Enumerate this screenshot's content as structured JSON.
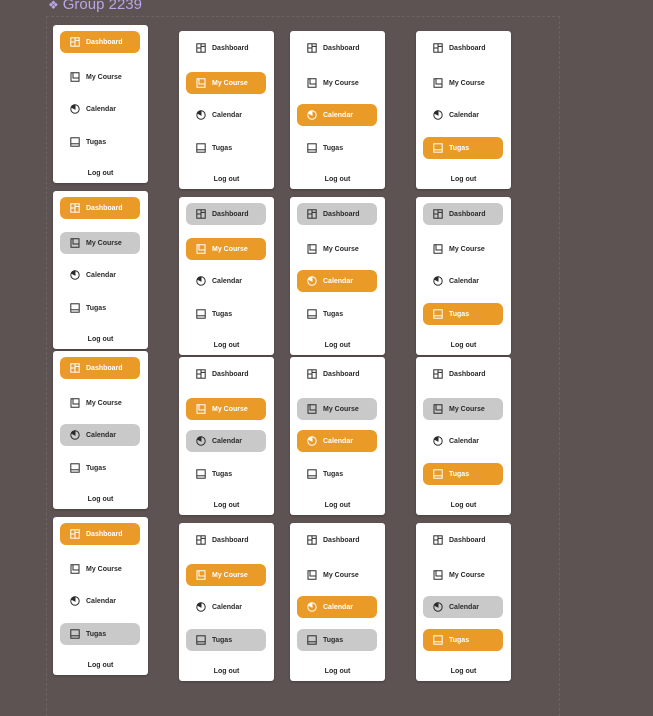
{
  "frame": {
    "title": "Group 2239"
  },
  "nav": {
    "labels": [
      "Dashboard",
      "My Course",
      "Calendar",
      "Tugas"
    ],
    "icons": [
      "dashboard-icon",
      "book-icon",
      "calendar-icon",
      "tasks-icon"
    ],
    "logout": "Log out"
  },
  "colors": {
    "active": "#e99a27",
    "hover": "#c9c9c9",
    "card": "#ffffff",
    "background": "#5e5353"
  },
  "cards": [
    {
      "states": [
        "active",
        "none",
        "none",
        "none"
      ]
    },
    {
      "states": [
        "none",
        "active",
        "none",
        "none"
      ]
    },
    {
      "states": [
        "none",
        "none",
        "active",
        "none"
      ]
    },
    {
      "states": [
        "none",
        "none",
        "none",
        "active"
      ]
    },
    {
      "states": [
        "active",
        "grey",
        "none",
        "none"
      ]
    },
    {
      "states": [
        "grey",
        "active",
        "none",
        "none"
      ]
    },
    {
      "states": [
        "grey",
        "none",
        "active",
        "none"
      ]
    },
    {
      "states": [
        "grey",
        "none",
        "none",
        "active"
      ]
    },
    {
      "states": [
        "active",
        "none",
        "grey",
        "none"
      ]
    },
    {
      "states": [
        "none",
        "active",
        "grey",
        "none"
      ]
    },
    {
      "states": [
        "none",
        "grey",
        "active",
        "none"
      ]
    },
    {
      "states": [
        "none",
        "grey",
        "none",
        "active"
      ]
    },
    {
      "states": [
        "active",
        "none",
        "none",
        "grey"
      ]
    },
    {
      "states": [
        "none",
        "active",
        "none",
        "grey"
      ]
    },
    {
      "states": [
        "none",
        "none",
        "active",
        "grey"
      ]
    },
    {
      "states": [
        "none",
        "none",
        "grey",
        "active"
      ]
    }
  ]
}
